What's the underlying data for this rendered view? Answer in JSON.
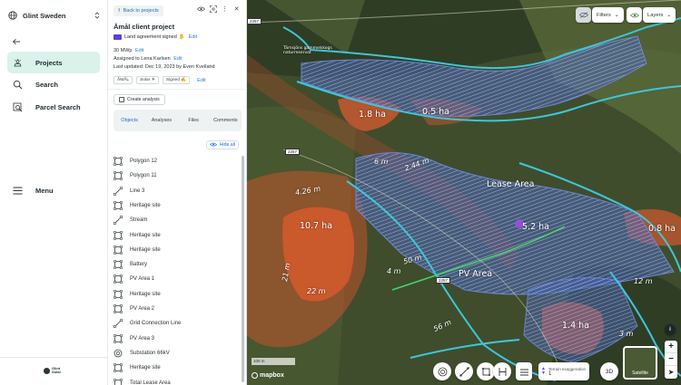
{
  "nav": {
    "org_name": "Glint Sweden",
    "items": [
      {
        "label": "Projects",
        "active": true
      },
      {
        "label": "Search",
        "active": false
      },
      {
        "label": "Parcel Search",
        "active": false
      }
    ],
    "menu_label": "Menu",
    "brand_line1": "Glint",
    "brand_line2": "Solar"
  },
  "panel": {
    "back_label": "Back to projects",
    "title": "Åmål client project",
    "land_status": "Land agreement signed",
    "edit_label": "Edit",
    "capacity": "30 MWp",
    "assigned_prefix": "Assigned to",
    "assigned_to": "Lena Karlsen",
    "updated_prefix": "Last updated: Dec 19, 2023 by",
    "updated_by": "Even Kvelland",
    "tags": [
      "ÅMÅL",
      "Solar ☀",
      "Signed ✍"
    ],
    "create_analysis": "Create analysis",
    "tabs": [
      {
        "label": "Objects",
        "active": true
      },
      {
        "label": "Analyses",
        "active": false
      },
      {
        "label": "Files",
        "active": false
      },
      {
        "label": "Comments",
        "active": false
      }
    ],
    "hide_all": "Hide all",
    "objects": [
      {
        "label": "Polygon 12",
        "icon": "polygon-icon"
      },
      {
        "label": "Polygon 11",
        "icon": "polygon-icon"
      },
      {
        "label": "Line 3",
        "icon": "line-icon"
      },
      {
        "label": "Heritage site",
        "icon": "polygon-icon"
      },
      {
        "label": "Stream",
        "icon": "line-icon"
      },
      {
        "label": "Heritage site",
        "icon": "polygon-icon"
      },
      {
        "label": "Heritage site",
        "icon": "polygon-icon"
      },
      {
        "label": "Battery",
        "icon": "polygon-icon"
      },
      {
        "label": "PV Area 1",
        "icon": "polygon-icon"
      },
      {
        "label": "Heritage site",
        "icon": "polygon-icon"
      },
      {
        "label": "PV Area 2",
        "icon": "polygon-icon"
      },
      {
        "label": "Grid Connection Line",
        "icon": "line-icon"
      },
      {
        "label": "PV Area 3",
        "icon": "polygon-icon"
      },
      {
        "label": "Substation 66kV",
        "icon": "target-icon"
      },
      {
        "label": "Heritage site",
        "icon": "polygon-icon"
      },
      {
        "label": "Total Lease Area",
        "icon": "polygon-icon"
      }
    ]
  },
  "map": {
    "filters_label": "Filters",
    "layers_label": "Layers",
    "labels": {
      "area_18": "1.8 ha",
      "area_05": "0.5 ha",
      "area_107": "10.7 ha",
      "area_52": "5.2 ha",
      "area_08": "0.8 ha",
      "area_14": "1.4 ha",
      "lease_area": "Lease Area",
      "pv_area": "PV Area",
      "reserve": "Tärnsjöns gammelskogs naturreservat",
      "d_426": "4.26 m",
      "d_244": "2.44 m",
      "d_21": "21 m",
      "d_22": "22 m",
      "d_50": "50 m",
      "d_56": "56 m",
      "d_6": "6 m",
      "d_4": "4 m",
      "d_12": "12 m",
      "d_3": "3 m"
    },
    "road_labels": [
      "2257",
      "2257",
      "2257"
    ],
    "scale_label": "100 m",
    "attribution": "mapbox",
    "terrain_label": "Terrain exaggeration",
    "terrain_value": "1",
    "btn_3d": "3D",
    "satellite_label": "Satellite"
  }
}
